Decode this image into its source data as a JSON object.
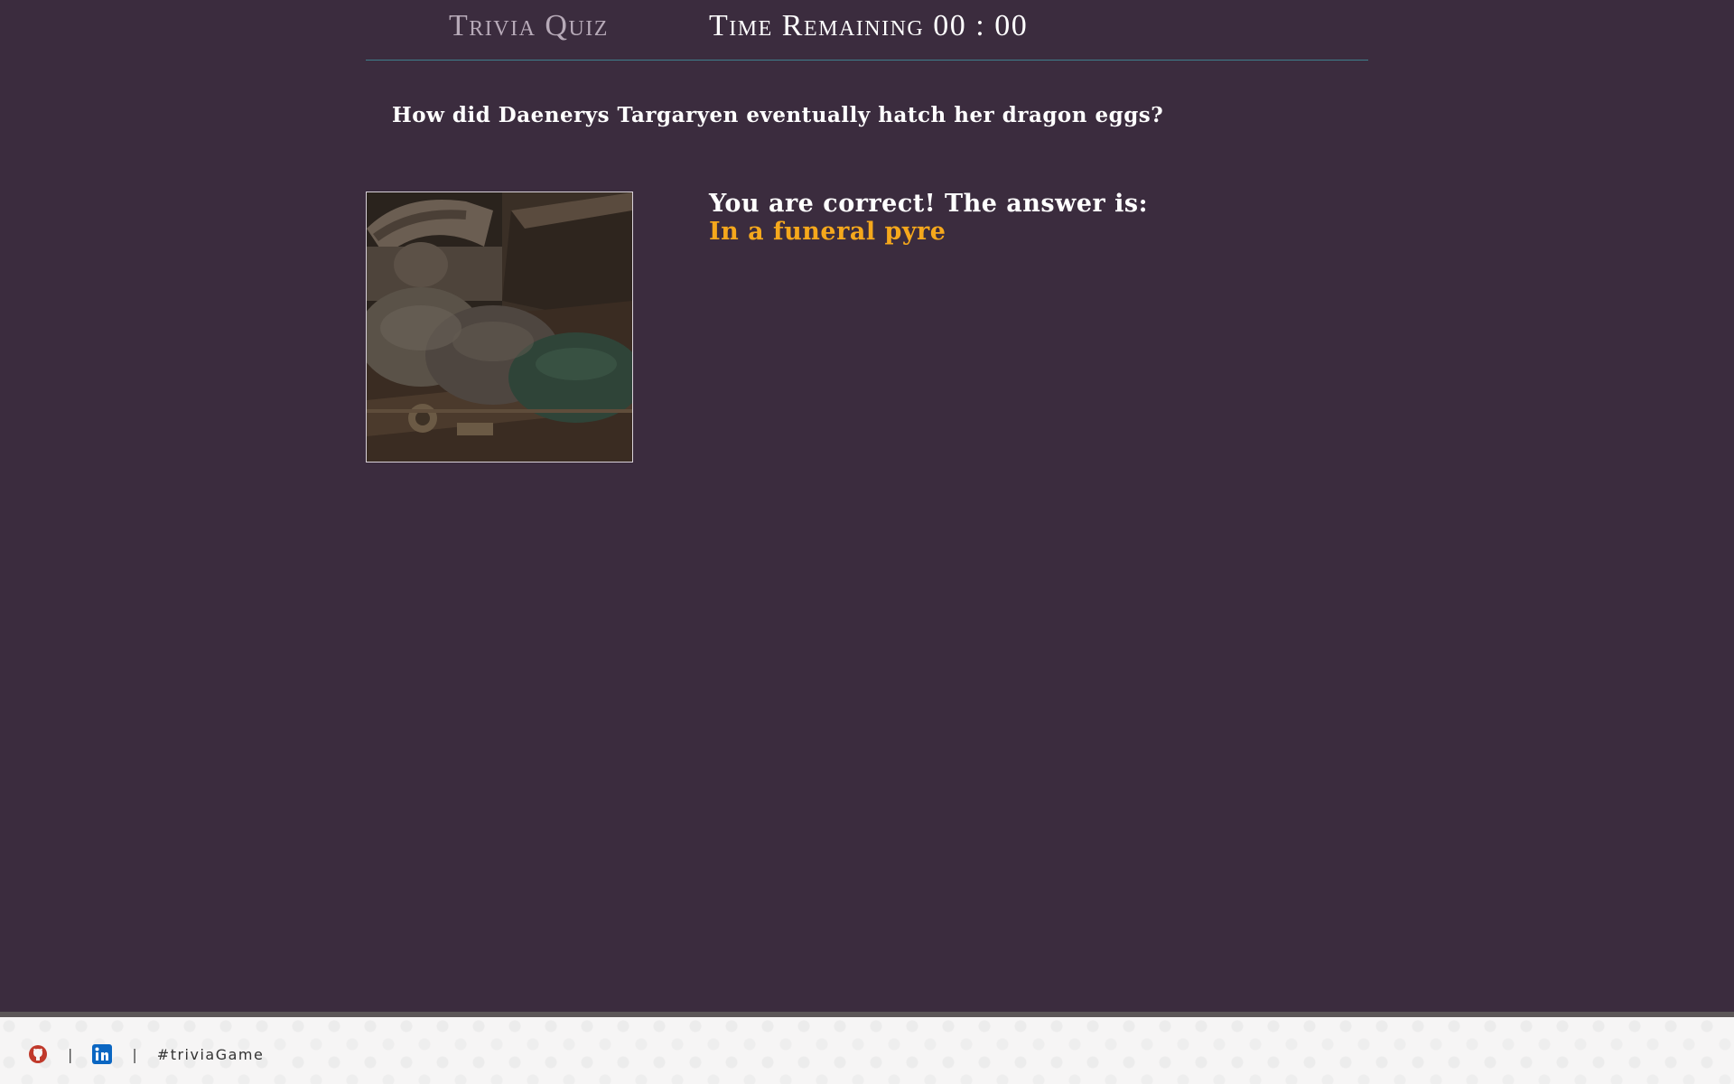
{
  "header": {
    "brand": "Trivia Quiz",
    "timer_label": "Time Remaining",
    "timer_value": "00 : 00"
  },
  "question": {
    "text": "How did Daenerys Targaryen eventually hatch her dragon eggs?"
  },
  "result": {
    "message": "You are correct! The answer is:",
    "answer": "In a funeral pyre"
  },
  "footer": {
    "separator": "|",
    "hashtag": "#triviaGame",
    "icons": [
      "github-icon",
      "linkedin-icon"
    ]
  },
  "colors": {
    "background": "#3b2c3e",
    "accent": "#f5a81c",
    "header_rule": "#3f7f8c",
    "github": "#c0392b",
    "linkedin": "#0a66c2"
  }
}
